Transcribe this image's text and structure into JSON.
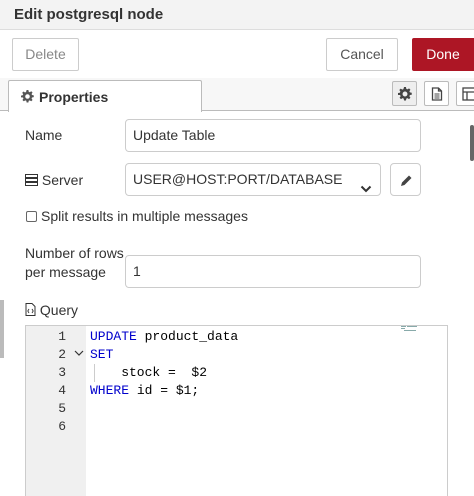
{
  "window": {
    "title": "Edit postgresql node"
  },
  "toolbar": {
    "delete_label": "Delete",
    "cancel_label": "Cancel",
    "done_label": "Done"
  },
  "tabs": [
    {
      "label": "Properties",
      "icon": "gear-icon"
    }
  ],
  "tab_icons": [
    "gear-icon",
    "document-icon",
    "layout-icon"
  ],
  "form": {
    "name_label": "Name",
    "name_value": "Update Table",
    "server_label": "Server",
    "server_value": "USER@HOST:PORT/DATABASE",
    "split_label": "Split results in multiple messages",
    "split_checked": false,
    "rows_label_line1": "Number of rows",
    "rows_label_line2": "per message",
    "rows_value": "1",
    "query_label": "Query"
  },
  "editor": {
    "lines": [
      {
        "num": "1",
        "kw": "UPDATE",
        "rest": " product_data",
        "fold": ""
      },
      {
        "num": "2",
        "kw": "SET",
        "rest": "",
        "fold": "v"
      },
      {
        "num": "3",
        "kw": "",
        "rest": "    stock =  $2",
        "fold": ""
      },
      {
        "num": "4",
        "kw": "WHERE",
        "rest": " id = $1;",
        "fold": ""
      },
      {
        "num": "5",
        "kw": "",
        "rest": "",
        "fold": ""
      },
      {
        "num": "6",
        "kw": "",
        "rest": "",
        "fold": ""
      }
    ]
  },
  "colors": {
    "accent": "#ad1625",
    "keyword": "#0000cc"
  }
}
